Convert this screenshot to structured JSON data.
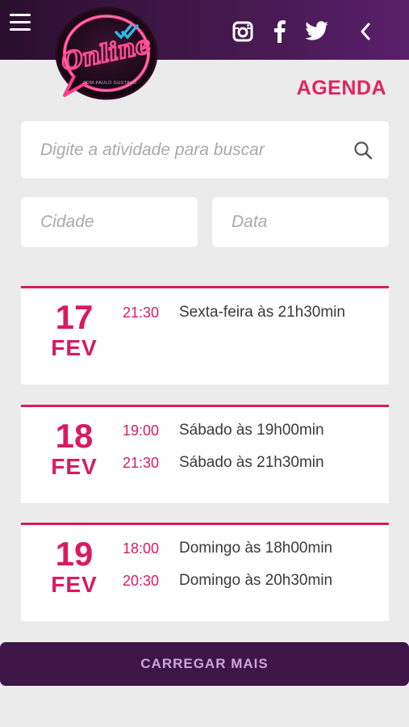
{
  "header": {
    "menu_icon": "hamburger-menu-icon",
    "social_icons": [
      "instagram-icon",
      "facebook-icon",
      "twitter-icon"
    ],
    "back_icon": "chevron-left-icon",
    "logo_text": "Online",
    "logo_subtext": "COM PAULO GUSTAVO"
  },
  "page": {
    "title": "AGENDA"
  },
  "search": {
    "placeholder": "Digite a atividade para buscar"
  },
  "filters": {
    "city_placeholder": "Cidade",
    "date_placeholder": "Data"
  },
  "events": [
    {
      "day": "17",
      "month": "FEV",
      "sessions": [
        {
          "time": "21:30",
          "description": "Sexta-feira às 21h30min"
        }
      ]
    },
    {
      "day": "18",
      "month": "FEV",
      "sessions": [
        {
          "time": "19:00",
          "description": "Sábado às 19h00min"
        },
        {
          "time": "21:30",
          "description": "Sábado às 21h30min"
        }
      ]
    },
    {
      "day": "19",
      "month": "FEV",
      "sessions": [
        {
          "time": "18:00",
          "description": "Domingo às 18h00min"
        },
        {
          "time": "20:30",
          "description": "Domingo às 20h30min"
        }
      ]
    }
  ],
  "load_more": {
    "label": "CARREGAR MAIS"
  },
  "colors": {
    "accent": "#d81b60",
    "header_bg": "#3f1747",
    "button_bg": "#3d1546",
    "button_text": "#c9a6dd",
    "page_bg": "#ebebeb"
  }
}
